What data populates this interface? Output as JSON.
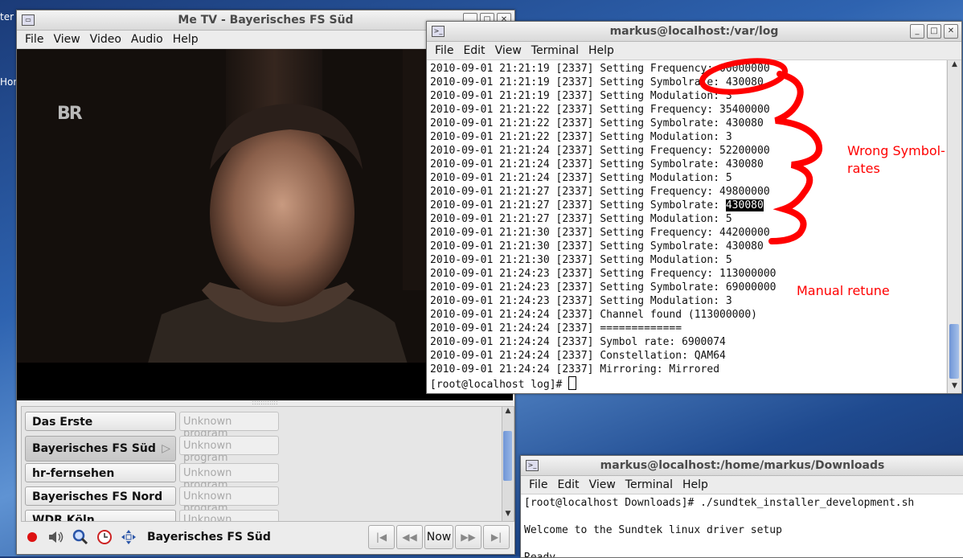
{
  "desktop": {
    "left_labels": [
      "ter",
      "Hor"
    ]
  },
  "metv": {
    "title": "Me TV - Bayerisches FS Süd",
    "menu": [
      "File",
      "View",
      "Video",
      "Audio",
      "Help"
    ],
    "video_logo": "BR",
    "channels": [
      {
        "name": "Das Erste",
        "program": "Unknown program"
      },
      {
        "name": "Bayerisches FS Süd",
        "program": "Unknown program",
        "active": true
      },
      {
        "name": "hr-fernsehen",
        "program": "Unknown program"
      },
      {
        "name": "Bayerisches FS Nord",
        "program": "Unknown program"
      },
      {
        "name": "WDR Köln",
        "program": "Unknown program"
      }
    ],
    "current_channel": "Bayerisches FS Süd",
    "nav": {
      "first": "|◀",
      "prev": "◀◀",
      "now": "Now",
      "next": "▶▶",
      "last": "▶|"
    }
  },
  "term1": {
    "title": "markus@localhost:/var/log",
    "menu": [
      "File",
      "Edit",
      "View",
      "Terminal",
      "Help"
    ],
    "lines": [
      "2010-09-01 21:21:19 [2337] Setting Frequency: 00000000",
      "2010-09-01 21:21:19 [2337] Setting Symbolrate: 430080",
      "2010-09-01 21:21:19 [2337] Setting Modulation: 3",
      "2010-09-01 21:21:22 [2337] Setting Frequency: 35400000",
      "2010-09-01 21:21:22 [2337] Setting Symbolrate: 430080",
      "2010-09-01 21:21:22 [2337] Setting Modulation: 3",
      "2010-09-01 21:21:24 [2337] Setting Frequency: 52200000",
      "2010-09-01 21:21:24 [2337] Setting Symbolrate: 430080",
      "2010-09-01 21:21:24 [2337] Setting Modulation: 5",
      "2010-09-01 21:21:27 [2337] Setting Frequency: 49800000",
      "2010-09-01 21:21:27 [2337] Setting Symbolrate: ",
      "2010-09-01 21:21:27 [2337] Setting Modulation: 5",
      "2010-09-01 21:21:30 [2337] Setting Frequency: 44200000",
      "2010-09-01 21:21:30 [2337] Setting Symbolrate: 430080",
      "2010-09-01 21:21:30 [2337] Setting Modulation: 5",
      "2010-09-01 21:24:23 [2337] Setting Frequency: 113000000",
      "2010-09-01 21:24:23 [2337] Setting Symbolrate: 69000000",
      "2010-09-01 21:24:23 [2337] Setting Modulation: 3",
      "2010-09-01 21:24:24 [2337] Channel found (113000000)",
      "2010-09-01 21:24:24 [2337] =============",
      "2010-09-01 21:24:24 [2337] Symbol rate: 6900074",
      "2010-09-01 21:24:24 [2337] Constellation: QAM64",
      "2010-09-01 21:24:24 [2337] Mirroring: Mirrored"
    ],
    "selected_value": "430080",
    "prompt": "[root@localhost log]# "
  },
  "annotations": {
    "wrong_line1": "Wrong Symbol-",
    "wrong_line2": "rates",
    "manual": "Manual retune",
    "color": "#ff0000"
  },
  "term2": {
    "title": "markus@localhost:/home/markus/Downloads",
    "menu": [
      "File",
      "Edit",
      "View",
      "Terminal",
      "Help"
    ],
    "lines": [
      "[root@localhost Downloads]# ./sundtek_installer_development.sh",
      "",
      "Welcome to the Sundtek linux driver setup",
      "",
      "Ready..."
    ]
  }
}
